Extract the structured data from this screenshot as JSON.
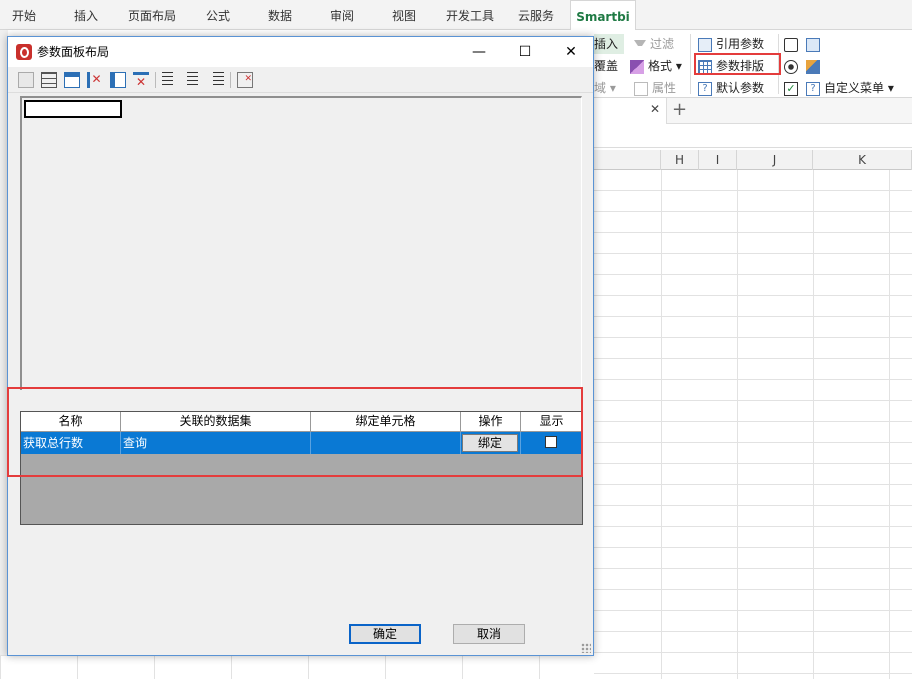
{
  "ribbon": {
    "tabs": [
      "开始",
      "插入",
      "页面布局",
      "公式",
      "数据",
      "审阅",
      "视图",
      "开发工具",
      "云服务",
      "Smartbi"
    ],
    "active_tab": "Smartbi",
    "partial_left": [
      "插入",
      "覆盖",
      "域"
    ],
    "filter_label": "过滤",
    "format_label": "格式",
    "property_label": "属性",
    "ref_param_label": "引用参数",
    "param_layout_label": "参数排版",
    "default_param_label": "默认参数",
    "custom_menu_label": "自定义菜单"
  },
  "sheet": {
    "columns": [
      "H",
      "I",
      "J",
      "K"
    ]
  },
  "dialog": {
    "title": "参数面板布局",
    "minimize": "—",
    "maximize": "☐",
    "close": "✕",
    "table": {
      "headers": [
        "名称",
        "关联的数据集",
        "绑定单元格",
        "操作",
        "显示"
      ],
      "rows": [
        {
          "name": "获取总行数",
          "dataset": "查询",
          "cell": "",
          "action": "绑定",
          "show": false
        }
      ]
    },
    "ok_label": "确定",
    "cancel_label": "取消"
  }
}
